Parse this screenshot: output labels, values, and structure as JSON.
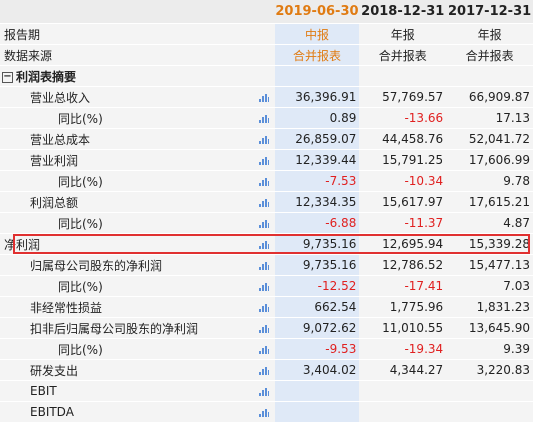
{
  "header": {
    "periods": [
      "2019-06-30",
      "2018-12-31",
      "2017-12-31"
    ]
  },
  "meta_rows": [
    {
      "label": "报告期",
      "values": [
        "中报",
        "年报",
        "年报"
      ]
    },
    {
      "label": "数据来源",
      "values": [
        "合并报表",
        "合并报表",
        "合并报表"
      ]
    }
  ],
  "section": {
    "label": "利润表摘要",
    "toggle": "−"
  },
  "rows": [
    {
      "label": "营业总收入",
      "level": 1,
      "values": [
        "36,396.91",
        "57,769.57",
        "66,909.87"
      ]
    },
    {
      "label": "同比(%)",
      "level": 2,
      "values": [
        "0.89",
        "-13.66",
        "17.13"
      ]
    },
    {
      "label": "营业总成本",
      "level": 1,
      "values": [
        "26,859.07",
        "44,458.76",
        "52,041.72"
      ]
    },
    {
      "label": "营业利润",
      "level": 1,
      "values": [
        "12,339.44",
        "15,791.25",
        "17,606.99"
      ]
    },
    {
      "label": "同比(%)",
      "level": 2,
      "values": [
        "-7.53",
        "-10.34",
        "9.78"
      ]
    },
    {
      "label": "利润总额",
      "level": 1,
      "values": [
        "12,334.35",
        "15,617.97",
        "17,615.21"
      ]
    },
    {
      "label": "同比(%)",
      "level": 2,
      "values": [
        "-6.88",
        "-11.37",
        "4.87"
      ]
    },
    {
      "label": "净利润",
      "level": 0,
      "values": [
        "9,735.16",
        "12,695.94",
        "15,339.28"
      ]
    },
    {
      "label": "归属母公司股东的净利润",
      "level": 1,
      "values": [
        "9,735.16",
        "12,786.52",
        "15,477.13"
      ]
    },
    {
      "label": "同比(%)",
      "level": 2,
      "values": [
        "-12.52",
        "-17.41",
        "7.03"
      ]
    },
    {
      "label": "非经常性损益",
      "level": 1,
      "values": [
        "662.54",
        "1,775.96",
        "1,831.23"
      ]
    },
    {
      "label": "扣非后归属母公司股东的净利润",
      "level": 1,
      "values": [
        "9,072.62",
        "11,010.55",
        "13,645.90"
      ]
    },
    {
      "label": "同比(%)",
      "level": 2,
      "values": [
        "-9.53",
        "-19.34",
        "9.39"
      ]
    },
    {
      "label": "研发支出",
      "level": 1,
      "values": [
        "3,404.02",
        "4,344.27",
        "3,220.83"
      ]
    },
    {
      "label": "EBIT",
      "level": 1,
      "values": [
        "",
        "",
        ""
      ]
    },
    {
      "label": "EBITDA",
      "level": 1,
      "values": [
        "",
        "",
        ""
      ]
    }
  ],
  "colors": {
    "accent_orange": "#e07b12",
    "negative_red": "#e02020",
    "highlight_border": "#e03030",
    "icon_blue": "#5b8fd9"
  },
  "icons": {
    "row_chart": "bar-chart-icon",
    "section_toggle": "collapse-minus-icon"
  }
}
